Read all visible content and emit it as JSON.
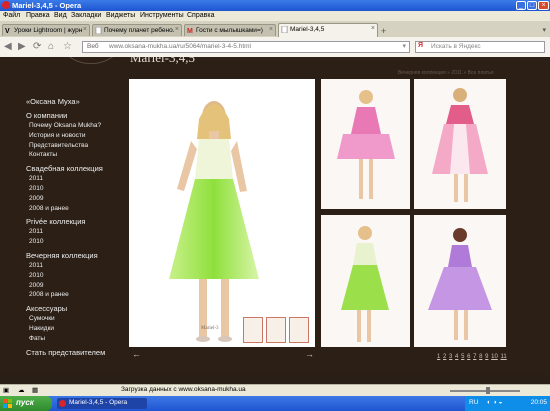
{
  "window": {
    "title": "Mariel-3,4,5 - Opera"
  },
  "menu": [
    "Файл",
    "Правка",
    "Вид",
    "Закладки",
    "Виджеты",
    "Инструменты",
    "Справка"
  ],
  "tabs": [
    {
      "label": "Уроки Lightroom | журн..."
    },
    {
      "label": "Почему плачет ребено..."
    },
    {
      "label": "Гости с мылышками=)"
    },
    {
      "label": "Mariel-3,4,5"
    }
  ],
  "address": {
    "web_label": "Веб",
    "url": "www.oksana-mukha.ua/ru/5064/mariel-3-4-5.html"
  },
  "search": {
    "placeholder": "Искать в Яндекс"
  },
  "page": {
    "title": "Mariel-3,4,5",
    "breadcrumb": "Вечерняя коллекция » 2011 » Все платья",
    "sidebar": [
      {
        "label": "«Оксана Муха»",
        "kind": "h"
      },
      {
        "label": "О компании",
        "kind": "h"
      },
      {
        "label": "Почему Oksana Mukha?",
        "kind": "s"
      },
      {
        "label": "История и новости",
        "kind": "s"
      },
      {
        "label": "Представительства",
        "kind": "s"
      },
      {
        "label": "Контакты",
        "kind": "s"
      },
      {
        "label": "Свадебная коллекция",
        "kind": "h"
      },
      {
        "label": "2011",
        "kind": "s"
      },
      {
        "label": "2010",
        "kind": "s"
      },
      {
        "label": "2009",
        "kind": "s"
      },
      {
        "label": "2008 и ранее",
        "kind": "s"
      },
      {
        "label": "Privée коллекция",
        "kind": "h"
      },
      {
        "label": "2011",
        "kind": "s"
      },
      {
        "label": "2010",
        "kind": "s"
      },
      {
        "label": "Вечерняя коллекция",
        "kind": "h"
      },
      {
        "label": "2011",
        "kind": "s"
      },
      {
        "label": "2010",
        "kind": "s"
      },
      {
        "label": "2009",
        "kind": "s"
      },
      {
        "label": "2008 и ранее",
        "kind": "s"
      },
      {
        "label": "Аксессуары",
        "kind": "h"
      },
      {
        "label": "Сумочки",
        "kind": "s"
      },
      {
        "label": "Накидки",
        "kind": "s"
      },
      {
        "label": "Фаты",
        "kind": "s"
      },
      {
        "label": "Стать представителем",
        "kind": "h"
      }
    ],
    "photo_caption": "Mariel-3",
    "pages": [
      "1",
      "2",
      "3",
      "4",
      "5",
      "6",
      "7",
      "8",
      "9",
      "10",
      "11"
    ],
    "arrow_prev": "←",
    "arrow_next": "→"
  },
  "status": {
    "message": "Загрузка данных с www.oksana-mukha.ua"
  },
  "taskbar": {
    "start": "пуск",
    "window": "Mariel-3,4,5 - Opera",
    "lang": "RU",
    "clock": "20:05"
  },
  "colors": {
    "page_bg": "#2b1f16",
    "dress_green": "#9be04a",
    "dress_pink": "#e879b5",
    "dress_violet": "#b07ad8"
  }
}
